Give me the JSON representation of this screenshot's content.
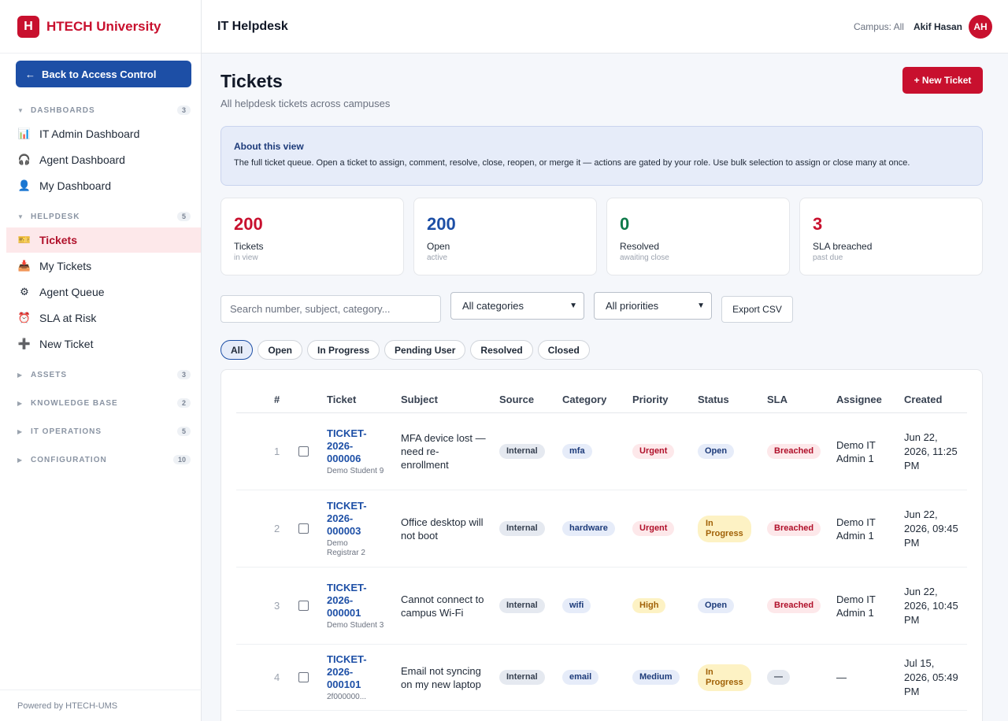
{
  "brand": {
    "logo_letter": "H",
    "name": "HTECH University"
  },
  "sidebar": {
    "back_label": "Back to Access Control",
    "back_arrow": "←",
    "sections": {
      "dashboards": {
        "label": "DASHBOARDS",
        "count": "3"
      },
      "helpdesk": {
        "label": "HELPDESK",
        "count": "5"
      },
      "assets": {
        "label": "ASSETS",
        "count": "3"
      },
      "knowledge_base": {
        "label": "KNOWLEDGE BASE",
        "count": "2"
      },
      "it_operations": {
        "label": "IT OPERATIONS",
        "count": "5"
      },
      "configuration": {
        "label": "CONFIGURATION",
        "count": "10"
      }
    },
    "items": {
      "it_admin_dashboard": {
        "label": "IT Admin Dashboard",
        "icon": "📊"
      },
      "agent_dashboard": {
        "label": "Agent Dashboard",
        "icon": "🎧"
      },
      "my_dashboard": {
        "label": "My Dashboard",
        "icon": "👤"
      },
      "tickets": {
        "label": "Tickets",
        "icon": "🎫"
      },
      "my_tickets": {
        "label": "My Tickets",
        "icon": "📥"
      },
      "agent_queue": {
        "label": "Agent Queue",
        "icon": "⚙"
      },
      "sla_at_risk": {
        "label": "SLA at Risk",
        "icon": "⏰"
      },
      "new_ticket": {
        "label": "New Ticket",
        "icon": "➕"
      }
    },
    "footer": "Powered by HTECH-UMS"
  },
  "topbar": {
    "title": "IT Helpdesk",
    "campus": "Campus: All",
    "user": "Akif Hasan",
    "avatar_initials": "AH"
  },
  "page": {
    "title": "Tickets",
    "subtitle": "All helpdesk tickets across campuses",
    "new_ticket_label": "+ New Ticket"
  },
  "about": {
    "title": "About this view",
    "text": "The full ticket queue. Open a ticket to assign, comment, resolve, close, reopen, or merge it — actions are gated by your role. Use bulk selection to assign or close many at once."
  },
  "stats": [
    {
      "value": "200",
      "label": "Tickets",
      "sub": "in view",
      "color": "#c8102e"
    },
    {
      "value": "200",
      "label": "Open",
      "sub": "active",
      "color": "#1d4fa6"
    },
    {
      "value": "0",
      "label": "Resolved",
      "sub": "awaiting close",
      "color": "#0f7a4a"
    },
    {
      "value": "3",
      "label": "SLA breached",
      "sub": "past due",
      "color": "#c8102e"
    }
  ],
  "filters": {
    "search_placeholder": "Search number, subject, category...",
    "category": "All categories",
    "priority": "All priorities",
    "export_label": "Export CSV",
    "status_chips": [
      "All",
      "Open",
      "In Progress",
      "Pending User",
      "Resolved",
      "Closed"
    ]
  },
  "table": {
    "headers": [
      "#",
      "Ticket",
      "Subject",
      "Source",
      "Category",
      "Priority",
      "Status",
      "SLA",
      "Assignee",
      "Created"
    ],
    "rows": [
      {
        "n": "1",
        "ticket": "TICKET-2026-000006",
        "requester": "Demo Student 9",
        "subject": "MFA device lost — need re-enrollment",
        "source": "Internal",
        "category": "mfa",
        "priority": "Urgent",
        "status": "Open",
        "sla": "Breached",
        "assignee": "Demo IT Admin 1",
        "created": "Jun 22, 2026, 11:25 PM"
      },
      {
        "n": "2",
        "ticket": "TICKET-2026-000003",
        "requester": "Demo Registrar 2",
        "subject": "Office desktop will not boot",
        "source": "Internal",
        "category": "hardware",
        "priority": "Urgent",
        "status": "In Progress",
        "sla": "Breached",
        "assignee": "Demo IT Admin 1",
        "created": "Jun 22, 2026, 09:45 PM"
      },
      {
        "n": "3",
        "ticket": "TICKET-2026-000001",
        "requester": "Demo Student 3",
        "subject": "Cannot connect to campus Wi-Fi",
        "source": "Internal",
        "category": "wifi",
        "priority": "High",
        "status": "Open",
        "sla": "Breached",
        "assignee": "Demo IT Admin 1",
        "created": "Jun 22, 2026, 10:45 PM"
      },
      {
        "n": "4",
        "ticket": "TICKET-2026-000101",
        "requester": "2f000000...",
        "subject": "Email not syncing on my new laptop",
        "source": "Internal",
        "category": "email",
        "priority": "Medium",
        "status": "In Progress",
        "sla": "—",
        "assignee": "—",
        "created": "Jul 15, 2026, 05:49 PM"
      }
    ]
  }
}
